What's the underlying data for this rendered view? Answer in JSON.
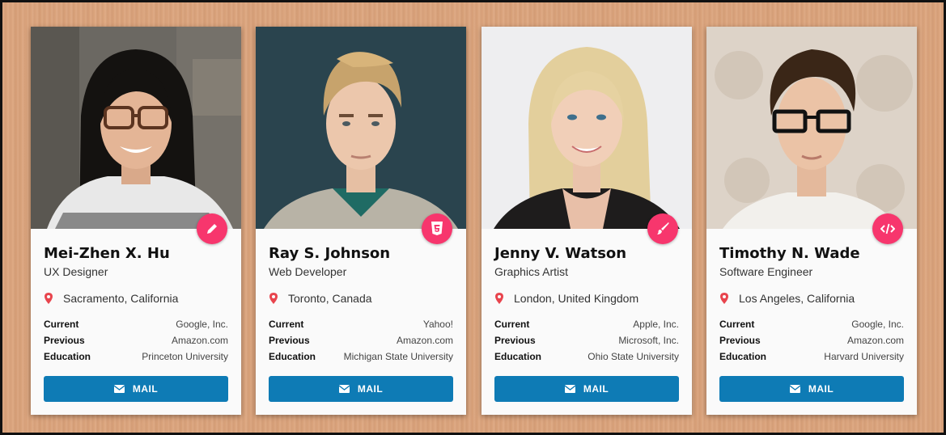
{
  "cards": [
    {
      "name": "Mei-Zhen X. Hu",
      "title": "UX Designer",
      "location": "Sacramento, California",
      "badge_icon": "pencil-icon",
      "rows": [
        {
          "label": "Current",
          "value": "Google, Inc."
        },
        {
          "label": "Previous",
          "value": "Amazon.com"
        },
        {
          "label": "Education",
          "value": "Princeton University"
        }
      ],
      "button": "MAIL"
    },
    {
      "name": "Ray S. Johnson",
      "title": "Web Developer",
      "location": "Toronto, Canada",
      "badge_icon": "html5-icon",
      "rows": [
        {
          "label": "Current",
          "value": "Yahoo!"
        },
        {
          "label": "Previous",
          "value": "Amazon.com"
        },
        {
          "label": "Education",
          "value": "Michigan State University"
        }
      ],
      "button": "MAIL"
    },
    {
      "name": "Jenny V. Watson",
      "title": "Graphics Artist",
      "location": "London, United Kingdom",
      "badge_icon": "paintbrush-icon",
      "rows": [
        {
          "label": "Current",
          "value": "Apple, Inc."
        },
        {
          "label": "Previous",
          "value": "Microsoft, Inc."
        },
        {
          "label": "Education",
          "value": "Ohio State University"
        }
      ],
      "button": "MAIL"
    },
    {
      "name": "Timothy N. Wade",
      "title": "Software Engineer",
      "location": "Los Angeles, California",
      "badge_icon": "code-icon",
      "rows": [
        {
          "label": "Current",
          "value": "Google, Inc."
        },
        {
          "label": "Previous",
          "value": "Amazon.com"
        },
        {
          "label": "Education",
          "value": "Harvard University"
        }
      ],
      "button": "MAIL"
    }
  ],
  "colors": {
    "accent_badge": "#f7366d",
    "button": "#0e7bb5",
    "pin": "#e8444d",
    "background": "#dca57e"
  }
}
